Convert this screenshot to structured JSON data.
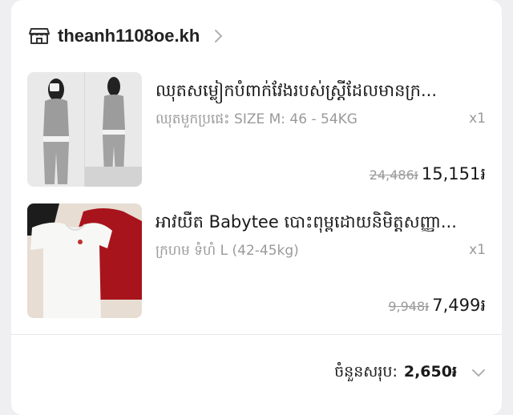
{
  "shop": {
    "name": "theanh1108oe.kh",
    "icon": "store-icon"
  },
  "items": [
    {
      "title": "ឈុតសម្លៀកបំពាក់វែងរបស់ស្ត្រីដែលមានក្រ...",
      "variant": "ឈុតមួកប្រផេះ SIZE M: 46 - 54KG",
      "qty": "x1",
      "price_old": "24,486៛",
      "price_new": "15,151៛"
    },
    {
      "title": "អាវយឺត Babytee បោះពុម្ពដោយនិមិត្តសញ្ញា...",
      "variant": "ក្រហម ទំហំ L (42-45kg)",
      "qty": "x1",
      "price_old": "9,948៛",
      "price_new": "7,499៛"
    }
  ],
  "total": {
    "label": "ចំនួនសរុប:",
    "value": "2,650៛"
  },
  "colors": {
    "text": "#1a1a1a",
    "muted": "#9a9a9a",
    "background": "#efeff1",
    "card": "#ffffff"
  }
}
